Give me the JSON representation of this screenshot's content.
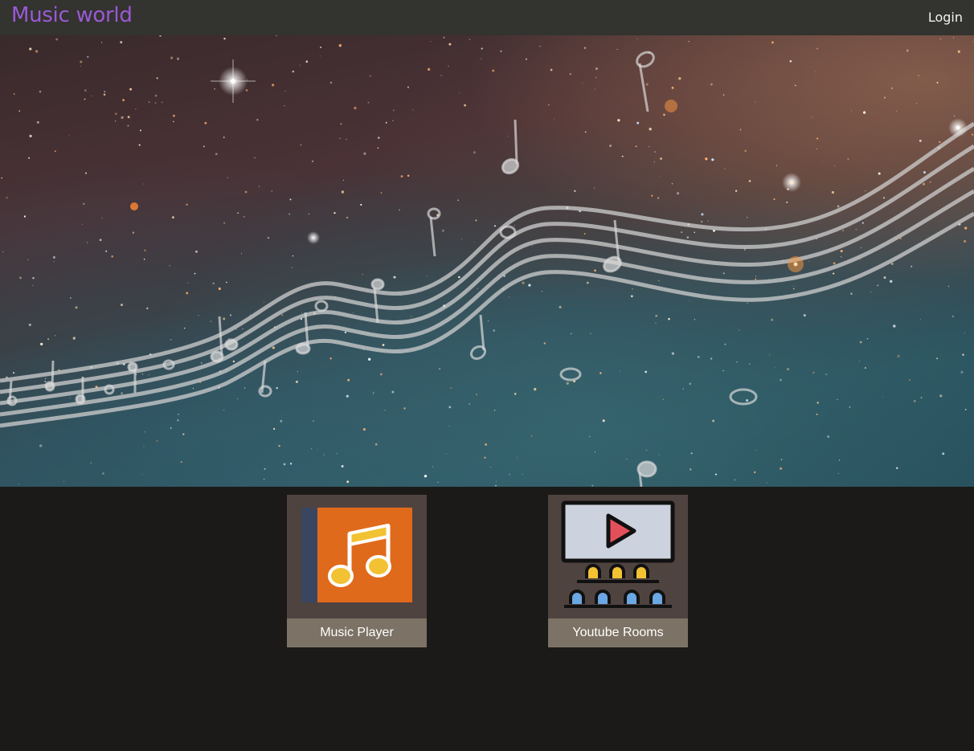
{
  "header": {
    "brand": "Music world",
    "login_label": "Login"
  },
  "hero": {
    "image": "space-music-staff-banner"
  },
  "apps": [
    {
      "label": "Music Player",
      "icon": "music-note-icon"
    },
    {
      "label": "Youtube Rooms",
      "icon": "video-theater-icon"
    }
  ],
  "colors": {
    "brand": "#9b59d6",
    "topbar": "#33332f",
    "page_bg": "#1b1a18",
    "card_bg": "#4f4340",
    "caption_bg": "#7c7265"
  }
}
